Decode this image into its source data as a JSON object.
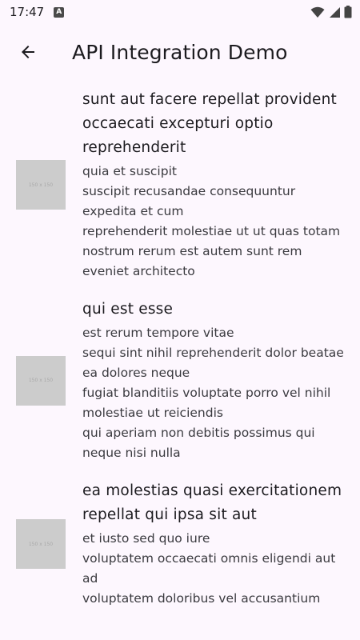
{
  "status_bar": {
    "time": "17:47",
    "notification_badge": "A",
    "icons": [
      "wifi-icon",
      "signal-icon",
      "battery-icon"
    ]
  },
  "app_bar": {
    "back_icon": "arrow-back-icon",
    "title": "API Integration Demo"
  },
  "posts": [
    {
      "thumbnail_label": "150 x 150",
      "title": "sunt aut facere repellat provident occaecati excepturi optio reprehenderit",
      "body": "quia et suscipit\nsuscipit recusandae consequuntur expedita et cum\nreprehenderit molestiae ut ut quas totam\nnostrum rerum est autem sunt rem eveniet architecto"
    },
    {
      "thumbnail_label": "150 x 150",
      "title": "qui est esse",
      "body": "est rerum tempore vitae\nsequi sint nihil reprehenderit dolor beatae ea dolores neque\nfugiat blanditiis voluptate porro vel nihil molestiae ut reiciendis\nqui aperiam non debitis possimus qui neque nisi nulla"
    },
    {
      "thumbnail_label": "150 x 150",
      "title": "ea molestias quasi exercitationem repellat qui ipsa sit aut",
      "body": "et iusto sed quo iure\nvoluptatem occaecati omnis eligendi aut ad\nvoluptatem doloribus vel accusantium"
    }
  ]
}
